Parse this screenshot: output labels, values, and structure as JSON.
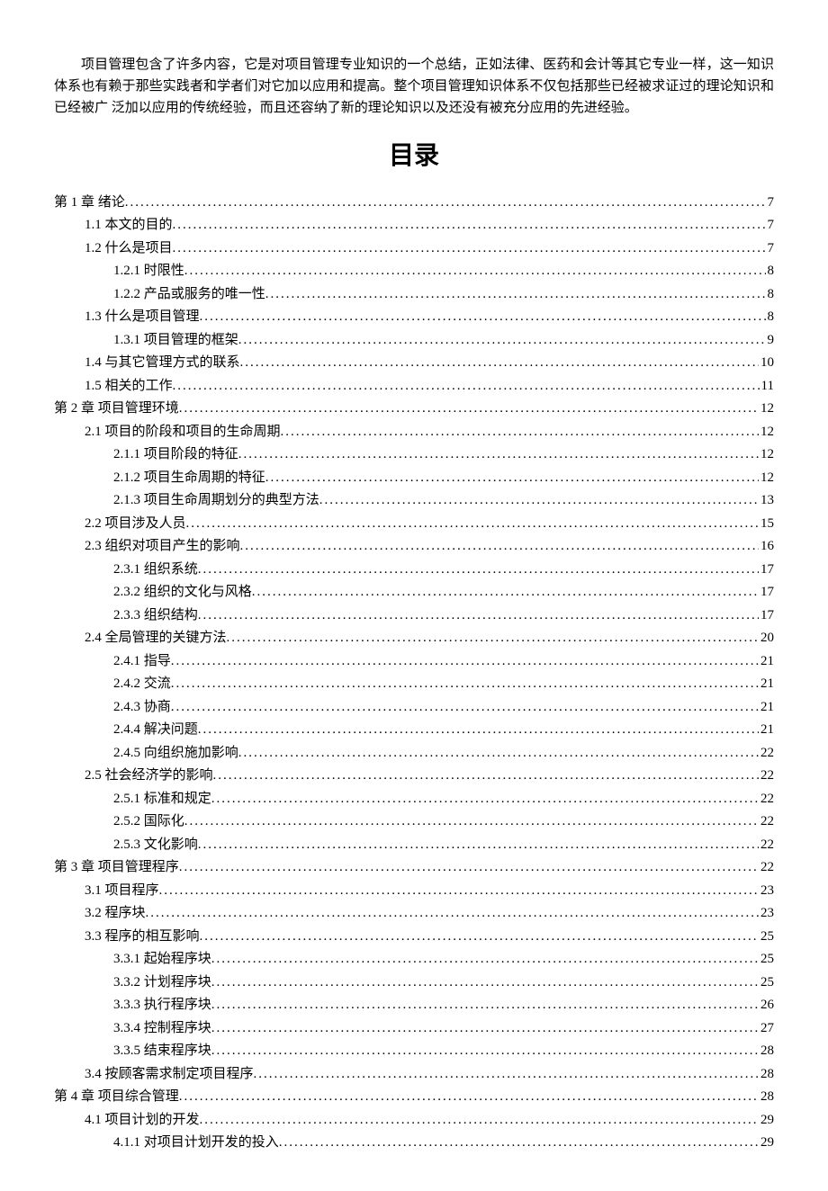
{
  "intro": "项目管理包含了许多内容，它是对项目管理专业知识的一个总结，正如法律、医药和会计等其它专业一样，这一知识体系也有赖于那些实践者和学者们对它加以应用和提高。整个项目管理知识体系不仅包括那些已经被求证过的理论知识和已经被广 泛加以应用的传统经验，而且还容纳了新的理论知识以及还没有被充分应用的先进经验。",
  "toc_title": "目录",
  "toc": [
    {
      "level": 0,
      "label": "第 1 章 绪论",
      "page": "7"
    },
    {
      "level": 1,
      "label": "1.1 本文的目的",
      "page": "7"
    },
    {
      "level": 1,
      "label": "1.2 什么是项目",
      "page": "7"
    },
    {
      "level": 2,
      "label": "1.2.1 时限性",
      "page": "8"
    },
    {
      "level": 2,
      "label": "1.2.2 产品或服务的唯一性",
      "page": "8"
    },
    {
      "level": 1,
      "label": "1.3 什么是项目管理",
      "page": "8"
    },
    {
      "level": 2,
      "label": "1.3.1 项目管理的框架",
      "page": "9"
    },
    {
      "level": 1,
      "label": "1.4 与其它管理方式的联系",
      "page": "10"
    },
    {
      "level": 1,
      "label": "1.5 相关的工作",
      "page": "11"
    },
    {
      "level": 0,
      "label": "第 2 章 项目管理环境",
      "page": "12"
    },
    {
      "level": 1,
      "label": "2.1 项目的阶段和项目的生命周期",
      "page": "12"
    },
    {
      "level": 2,
      "label": "2.1.1 项目阶段的特征",
      "page": "12"
    },
    {
      "level": 2,
      "label": "2.1.2 项目生命周期的特征",
      "page": "12"
    },
    {
      "level": 2,
      "label": "2.1.3 项目生命周期划分的典型方法",
      "page": "13"
    },
    {
      "level": 1,
      "label": "2.2 项目涉及人员",
      "page": "15"
    },
    {
      "level": 1,
      "label": "2.3 组织对项目产生的影响",
      "page": "16"
    },
    {
      "level": 2,
      "label": "2.3.1 组织系统",
      "page": "17"
    },
    {
      "level": 2,
      "label": "2.3.2 组织的文化与风格",
      "page": "17"
    },
    {
      "level": 2,
      "label": "2.3.3 组织结构",
      "page": "17"
    },
    {
      "level": 1,
      "label": "2.4 全局管理的关键方法",
      "page": "20"
    },
    {
      "level": 2,
      "label": "2.4.1 指导",
      "page": "21"
    },
    {
      "level": 2,
      "label": "2.4.2 交流",
      "page": "21"
    },
    {
      "level": 2,
      "label": "2.4.3 协商",
      "page": "21"
    },
    {
      "level": 2,
      "label": "2.4.4 解决问题",
      "page": "21"
    },
    {
      "level": 2,
      "label": "2.4.5 向组织施加影响",
      "page": "22"
    },
    {
      "level": 1,
      "label": "2.5 社会经济学的影响",
      "page": "22"
    },
    {
      "level": 2,
      "label": "2.5.1 标准和规定",
      "page": "22"
    },
    {
      "level": 2,
      "label": "2.5.2 国际化",
      "page": "22"
    },
    {
      "level": 2,
      "label": "2.5.3 文化影响",
      "page": "22"
    },
    {
      "level": 0,
      "label": "第 3 章 项目管理程序",
      "page": "22"
    },
    {
      "level": 1,
      "label": "3.1 项目程序",
      "page": "23"
    },
    {
      "level": 1,
      "label": "3.2 程序块",
      "page": "23"
    },
    {
      "level": 1,
      "label": "3.3 程序的相互影响",
      "page": "25"
    },
    {
      "level": 2,
      "label": "3.3.1 起始程序块",
      "page": "25"
    },
    {
      "level": 2,
      "label": "3.3.2 计划程序块",
      "page": "25"
    },
    {
      "level": 2,
      "label": "3.3.3 执行程序块",
      "page": "26"
    },
    {
      "level": 2,
      "label": "3.3.4 控制程序块",
      "page": "27"
    },
    {
      "level": 2,
      "label": "3.3.5 结束程序块",
      "page": "28"
    },
    {
      "level": 1,
      "label": "3.4 按顾客需求制定项目程序",
      "page": "28"
    },
    {
      "level": 0,
      "label": "第 4 章 项目综合管理",
      "page": "28"
    },
    {
      "level": 1,
      "label": "4.1 项目计划的开发",
      "page": "29"
    },
    {
      "level": 2,
      "label": "4.1.1 对项目计划开发的投入",
      "page": "29"
    }
  ]
}
